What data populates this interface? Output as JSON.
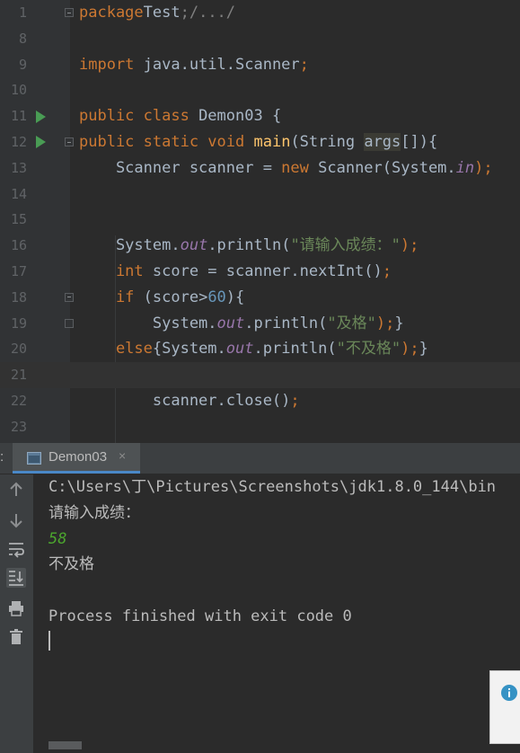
{
  "editor": {
    "lines": [
      {
        "num": "1",
        "tokens": [
          [
            "kw",
            "package"
          ],
          [
            "",
            "Test"
          ],
          [
            "cmt",
            ";/.../"
          ]
        ]
      },
      {
        "num": "8",
        "tokens": []
      },
      {
        "num": "9",
        "tokens": [
          [
            "kw",
            "import"
          ],
          [
            "",
            " java.util.Scanner"
          ],
          [
            "kw",
            ";"
          ]
        ]
      },
      {
        "num": "10",
        "tokens": []
      },
      {
        "num": "11",
        "tokens": [
          [
            "kw",
            "public class"
          ],
          [
            "",
            " Demon03 {"
          ]
        ]
      },
      {
        "num": "12",
        "tokens": [
          [
            "kw",
            "public static void"
          ],
          [
            "",
            " "
          ],
          [
            "fn",
            "main"
          ],
          [
            "",
            "(String "
          ],
          [
            "hl",
            "args"
          ],
          [
            "",
            "[]){"
          ]
        ]
      },
      {
        "num": "13",
        "tokens": [
          [
            "",
            "    Scanner scanner = "
          ],
          [
            "kw",
            "new"
          ],
          [
            "",
            " Scanner(System."
          ],
          [
            "fld",
            "in"
          ],
          [
            "kw",
            ");"
          ]
        ]
      },
      {
        "num": "14",
        "tokens": []
      },
      {
        "num": "15",
        "tokens": []
      },
      {
        "num": "16",
        "tokens": [
          [
            "",
            "    System."
          ],
          [
            "fld",
            "out"
          ],
          [
            "",
            ".println("
          ],
          [
            "str",
            "\"请输入成绩：\""
          ],
          [
            "kw",
            ");"
          ]
        ]
      },
      {
        "num": "17",
        "tokens": [
          [
            "kw",
            "    int"
          ],
          [
            "",
            " score = scanner.nextInt()"
          ],
          [
            "kw",
            ";"
          ]
        ]
      },
      {
        "num": "18",
        "tokens": [
          [
            "kw",
            "    if"
          ],
          [
            "",
            " (score>"
          ],
          [
            "num",
            "60"
          ],
          [
            "",
            "){"
          ]
        ]
      },
      {
        "num": "19",
        "tokens": [
          [
            "",
            "        System."
          ],
          [
            "fld",
            "out"
          ],
          [
            "",
            ".println("
          ],
          [
            "str",
            "\"及格\""
          ],
          [
            "kw",
            ");"
          ],
          [
            "",
            "}"
          ]
        ]
      },
      {
        "num": "20",
        "tokens": [
          [
            "kw",
            "    else"
          ],
          [
            "",
            "{System."
          ],
          [
            "fld",
            "out"
          ],
          [
            "",
            ".println("
          ],
          [
            "str",
            "\"不及格\""
          ],
          [
            "kw",
            ");"
          ],
          [
            "",
            "}"
          ]
        ]
      },
      {
        "num": "21",
        "tokens": []
      },
      {
        "num": "22",
        "tokens": [
          [
            "",
            "        scanner.close()"
          ],
          [
            "kw",
            ";"
          ]
        ]
      },
      {
        "num": "23",
        "tokens": []
      }
    ]
  },
  "run_panel": {
    "tab_label": "Demon03",
    "tab_close": "×",
    "sidebar_label": ":",
    "console_lines": [
      {
        "text": "C:\\Users\\丁\\Pictures\\Screenshots\\jdk1.8.0_144\\bin",
        "color": "#bbbbbb",
        "italic": false
      },
      {
        "text": "请输入成绩：",
        "color": "#bbbbbb",
        "italic": false
      },
      {
        "text": "58",
        "color": "#4ca62e",
        "italic": true
      },
      {
        "text": "不及格",
        "color": "#bbbbbb",
        "italic": false
      },
      {
        "text": "",
        "color": "#bbbbbb",
        "italic": false
      },
      {
        "text": "Process finished with exit code 0",
        "color": "#bbbbbb",
        "italic": false
      }
    ]
  },
  "icons": {
    "up": "up-arrow-icon",
    "down": "down-arrow-icon",
    "wrap": "soft-wrap-icon",
    "scroll": "scroll-to-end-icon",
    "print": "print-icon",
    "trash": "trash-icon",
    "info": "info-icon"
  }
}
